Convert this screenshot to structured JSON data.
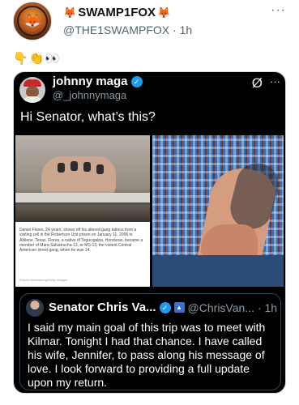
{
  "outer": {
    "name": "SWAMP1FOX",
    "handle": "@THE1SWAMPFOX",
    "time": "1h",
    "more": "···",
    "emoji_line": "👇👏👀",
    "fox_emoji": "🦊"
  },
  "embed": {
    "name": "johnny maga",
    "handle": "@_johnnymaga",
    "text": "Hi Senator, what’s this?",
    "more": "···",
    "photo_caption": "Daniel Flores, 24 years, shows off his altered gang tattoos from a visiting cell in the Robertson Unit prison on January 11, 2006 in Abilene, Texas. Flores, a native of Tegucigalpa, Honduras, became a member of Mara Salvatrucha-13, or MS-13, the violent Central American street gang, when he was 14.",
    "photo_credit": "Robert Nickelsberg/Getty Images",
    "quote": {
      "name": "Senator Chris Va...",
      "handle": "@ChrisVan...",
      "time": "· 1h",
      "text": "I said my main goal of this trip was to meet with Kilmar. Tonight I had that chance. I have called his wife, Jennifer, to pass along his message of love. I look forward to providing a full update upon my return."
    }
  },
  "colors": {
    "verified_blue": "#1d9bf0",
    "dark_bg": "#000000",
    "muted_text": "#536471"
  }
}
